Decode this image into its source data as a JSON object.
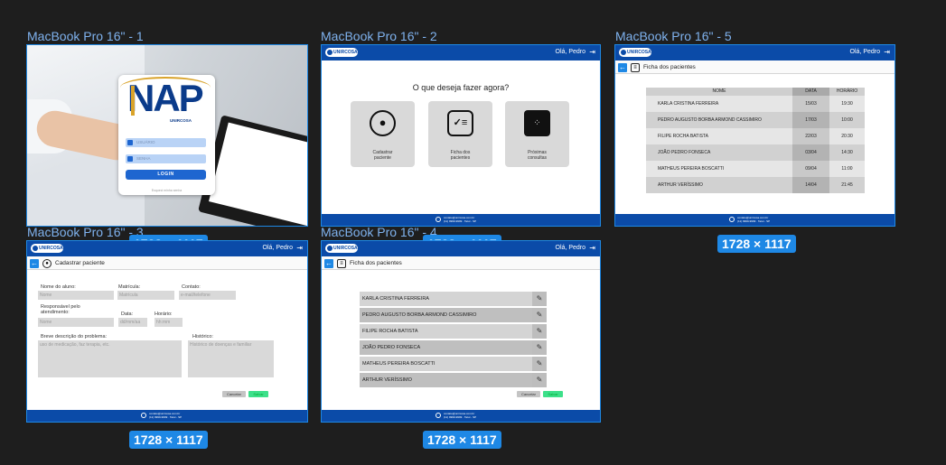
{
  "frames": [
    {
      "label": "MacBook Pro 16\" - 1",
      "size": "1728 × 1117"
    },
    {
      "label": "MacBook Pro 16\" - 2",
      "size": "1728 × 1117"
    },
    {
      "label": "MacBook Pro 16\" - 5",
      "size": "1728 × 1117"
    },
    {
      "label": "MacBook Pro 16\" - 3",
      "size": "1728 × 1117"
    },
    {
      "label": "MacBook Pro 16\" - 4",
      "size": "1728 × 1117"
    }
  ],
  "brand": {
    "logo_text": "UNIRCOSA",
    "greeting": "Olá, Pedro",
    "primary": "#0b4ba8",
    "accent": "#1e88e5",
    "save_color": "#3de08a"
  },
  "footer": {
    "line1": "contato@unircosa.com.br",
    "line2": "(11) 9999-9999  ·  Tatuí - SP"
  },
  "login": {
    "logo_text": "NAP",
    "brand_text": "UNIRCOSA",
    "user_placeholder": "USUÁRIO",
    "pass_placeholder": "SENHA",
    "login_button": "LOGIN",
    "forgot": "Esqueci minha senha"
  },
  "home": {
    "question": "O que deseja fazer agora?",
    "options": [
      {
        "label": "Cadastrar\npaciente",
        "icon": "user-circle-icon"
      },
      {
        "label": "Ficha dos\npacientes",
        "icon": "checklist-icon"
      },
      {
        "label": "Próximas\nconsultas",
        "icon": "calendar-icon"
      }
    ]
  },
  "register": {
    "title": "Cadastrar paciente",
    "student_label": "Nome do aluno:",
    "student_placeholder": "Nome",
    "matricula_label": "Matrícula:",
    "matricula_placeholder": "Matrícula",
    "contact_label": "Contato:",
    "contact_placeholder": "e-mail/telefone",
    "resp_label": "Responsável pelo\natendimento:",
    "resp_placeholder": "Nome",
    "date_label": "Data:",
    "date_placeholder": "dd/mm/aa",
    "time_label": "Horário:",
    "time_placeholder": "hh:mm",
    "desc_label": "Breve descrição do problema:",
    "desc_placeholder": "uso de medicação, faz terapia, etc.",
    "hist_label": "Histórico:",
    "hist_placeholder": "Histórico de doenças e familiar",
    "cancel": "Cancelar",
    "save": "Salvar"
  },
  "records": {
    "title": "Ficha dos pacientes",
    "patients": [
      "KARLA CRISTINA FERREIRA",
      "PEDRO AUGUSTO BORBA ARMOND CASSIMIRO",
      "FILIPE ROCHA BATISTA",
      "JOÃO PEDRO FONSECA",
      "MATHEUS PEREIRA BOSCATTI",
      "ARTHUR VERÍSSIMO"
    ],
    "cancel": "Cancelar",
    "save": "Salvar"
  },
  "schedule": {
    "title": "Ficha dos pacientes",
    "columns": [
      "NOME",
      "DATA",
      "HORÁRIO"
    ],
    "rows": [
      {
        "name": "KARLA CRISTINA FERREIRA",
        "date": "15/03",
        "time": "19:30"
      },
      {
        "name": "PEDRO AUGUSTO BORBA ARMOND CASSIMIRO",
        "date": "17/03",
        "time": "10:00"
      },
      {
        "name": "FILIPE ROCHA BATISTA",
        "date": "22/03",
        "time": "20:30"
      },
      {
        "name": "JOÃO PEDRO FONSECA",
        "date": "03/04",
        "time": "14:30"
      },
      {
        "name": "MATHEUS PEREIRA BOSCATTI",
        "date": "09/04",
        "time": "11:00"
      },
      {
        "name": "ARTHUR VERÍSSIMO",
        "date": "14/04",
        "time": "21:45"
      }
    ]
  }
}
